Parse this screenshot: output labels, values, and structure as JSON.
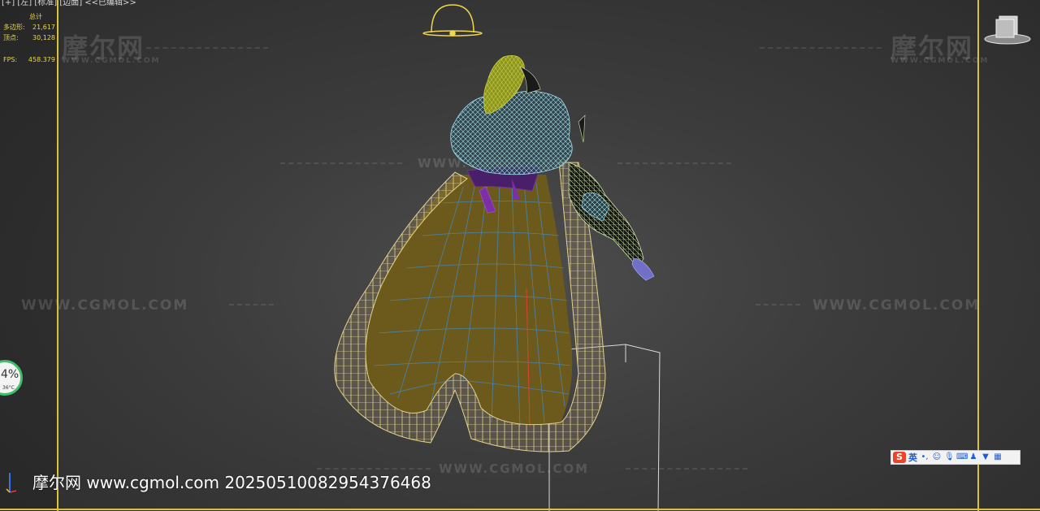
{
  "viewport": {
    "label": "[+] [左] [标准] [边面] <<已编辑>>",
    "background_color": "#3c3c3c",
    "frame_color": "#d8c23a"
  },
  "stats": {
    "header": "总计",
    "polygons_label": "多边形:",
    "polygons_value": "21,617",
    "vertices_label": "顶点:",
    "vertices_value": "30,128",
    "fps_label": "FPS:",
    "fps_value": "458.379"
  },
  "cpu_widget": {
    "percent": "4%",
    "temperature": "36°C",
    "ring_color": "#3fbf6a"
  },
  "watermarks": {
    "logo_cn": "摩尔网",
    "logo_en": "WWW.CGMOL.COM",
    "site": "WWW.CGMOL.COM"
  },
  "ime_toolbar": {
    "logo": "S",
    "language": "英",
    "icons": [
      "punctuation-icon",
      "emoji-icon",
      "microphone-icon",
      "keyboard-icon",
      "user-icon",
      "skin-icon",
      "grid-icon"
    ]
  },
  "bottom_watermark": "摩尔网 www.cgmol.com 20250510082954376468",
  "wire_colors": {
    "cape_trim": "#e2d38a",
    "cape_inner": "#6b5a1c",
    "cape_grid": "#3f8fd8",
    "collar": "#9fe0f0",
    "hair": "#c9d23a",
    "helmet_gizmo": "#f0d64a",
    "arm": "#cfe6a8",
    "box": "#dcdcdc",
    "belt": "#7d2fa8"
  }
}
